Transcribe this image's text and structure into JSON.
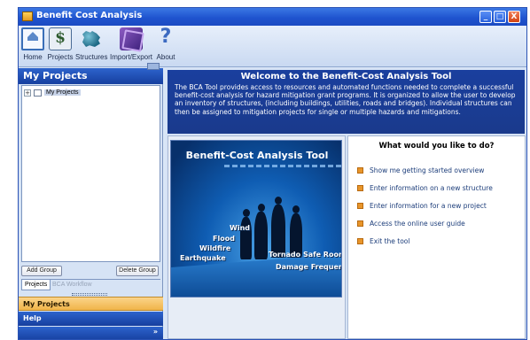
{
  "window": {
    "title": "Benefit Cost Analysis"
  },
  "window_controls": {
    "minimize": "_",
    "maximize": "□",
    "close": "X"
  },
  "toolbar": {
    "items": [
      {
        "label": "Home",
        "icon": "home-icon"
      },
      {
        "label": "Projects",
        "icon": "projects-icon"
      },
      {
        "label": "Structures",
        "icon": "structures-icon"
      },
      {
        "label": "Import/Export",
        "icon": "import-export-icon"
      },
      {
        "label": "About",
        "icon": "about-icon"
      }
    ]
  },
  "left_pane": {
    "title": "My Projects",
    "tree": {
      "expander": "+",
      "root_label": "My Projects"
    },
    "add_group_label": "Add Group",
    "delete_group_label": "Delete Group",
    "tabs": [
      {
        "label": "Projects"
      },
      {
        "label": "BCA Workflow"
      }
    ],
    "nav": [
      {
        "label": "My Projects"
      },
      {
        "label": "Help"
      }
    ],
    "footer_chevron": "»"
  },
  "welcome": {
    "title": "Welcome to the Benefit-Cost Analysis Tool",
    "body": "The BCA Tool provides access to resources and automated functions needed to complete a successful benefit-cost analysis for hazard mitigation grant programs.  It is organized to allow the user to develop an inventory of structures, (including buildings, utilities, roads and bridges). Individual structures can then be assigned to mitigation projects for single or multiple hazards and mitigations."
  },
  "hero": {
    "title": "Benefit-Cost Analysis Tool",
    "hazards": [
      "Wind",
      "Flood",
      "Wildfire",
      "Earthquake",
      "Tornado Safe Room",
      "Damage Frequency"
    ]
  },
  "actions": {
    "title": "What would you like to do?",
    "items": [
      {
        "label": "Show me getting started overview"
      },
      {
        "label": "Enter information on a new structure"
      },
      {
        "label": "Enter information for a new project"
      },
      {
        "label": "Access the online user guide"
      },
      {
        "label": "Exit the tool"
      }
    ]
  }
}
